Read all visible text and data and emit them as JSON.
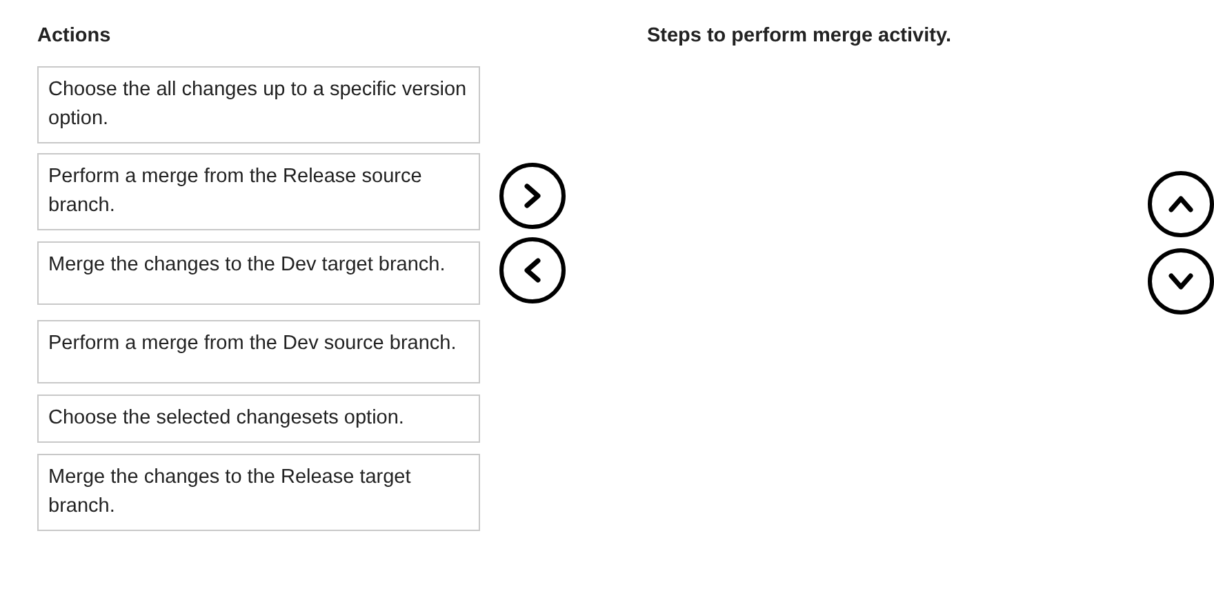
{
  "actions_heading": "Actions",
  "actions": [
    "Choose the all changes up to a specific version option.",
    "Perform a merge from the Release source branch.",
    "Merge the changes to the Dev target branch.",
    "Perform a merge from the Dev source branch.",
    "Choose the selected changesets option.",
    "Merge the changes to the Release target branch."
  ],
  "steps_heading": "Steps to perform merge activity."
}
